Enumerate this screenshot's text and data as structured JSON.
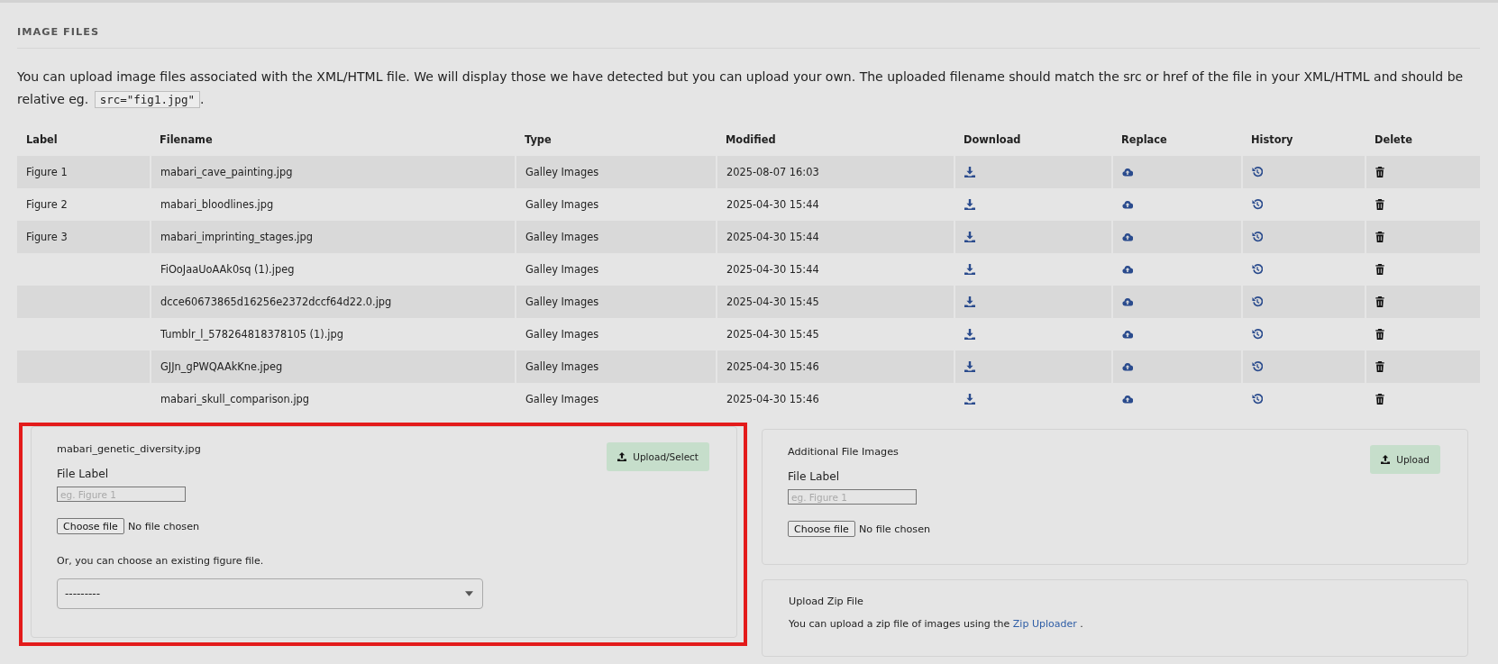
{
  "section": {
    "title": "IMAGE FILES"
  },
  "intro": {
    "text": "You can upload image files associated with the XML/HTML file. We will display those we have detected but you can upload your own. The uploaded filename should match the src or href of the file in your XML/HTML and should be relative eg.",
    "code": "src=\"fig1.jpg\"",
    "end": "."
  },
  "table": {
    "columns": [
      "Label",
      "Filename",
      "Type",
      "Modified",
      "Download",
      "Replace",
      "History",
      "Delete"
    ],
    "rows": [
      {
        "label": "Figure 1",
        "filename": "mabari_cave_painting.jpg",
        "type": "Galley Images",
        "modified": "2025-08-07 16:03"
      },
      {
        "label": "Figure 2",
        "filename": "mabari_bloodlines.jpg",
        "type": "Galley Images",
        "modified": "2025-04-30 15:44"
      },
      {
        "label": "Figure 3",
        "filename": "mabari_imprinting_stages.jpg",
        "type": "Galley Images",
        "modified": "2025-04-30 15:44"
      },
      {
        "filename": "FiOoJaaUoAAk0sq (1).jpeg",
        "type": "Galley Images",
        "modified": "2025-04-30 15:44"
      },
      {
        "filename": "dcce60673865d16256e2372dccf64d22.0.jpg",
        "type": "Galley Images",
        "modified": "2025-04-30 15:45"
      },
      {
        "filename": "Tumblr_l_578264818378105 (1).jpg",
        "type": "Galley Images",
        "modified": "2025-04-30 15:45"
      },
      {
        "filename": "GJJn_gPWQAAkKne.jpeg",
        "type": "Galley Images",
        "modified": "2025-04-30 15:46"
      },
      {
        "filename": "mabari_skull_comparison.jpg",
        "type": "Galley Images",
        "modified": "2025-04-30 15:46"
      }
    ]
  },
  "upload_panels": [
    {
      "kind": "figure",
      "highlighted": true,
      "title": "mabari_genetic_diversity.jpg",
      "field_label": "File Label",
      "placeholder": "eg. Figure 1",
      "file_button": "Choose file",
      "file_status": "No file chosen",
      "note": "Or, you can choose an existing figure file.",
      "select_value": "---------",
      "button": "Upload/Select"
    },
    {
      "kind": "additional",
      "highlighted": false,
      "title": "Additional File Images",
      "field_label": "File Label",
      "placeholder": "eg. Figure 1",
      "file_button": "Choose file",
      "file_status": "No file chosen",
      "button": "Upload"
    }
  ],
  "zip_panel": {
    "title": "Upload Zip File",
    "text": "You can upload a zip file of images using the",
    "link": "Zip Uploader",
    "end": "."
  }
}
